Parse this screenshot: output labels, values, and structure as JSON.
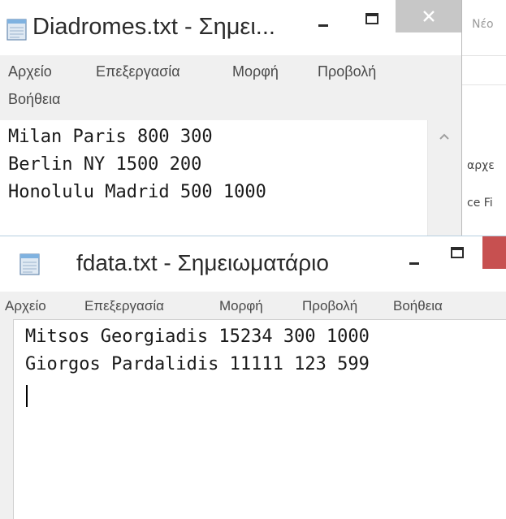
{
  "background_window": {
    "title_fragment": "Νέο",
    "fragments": [
      "αρχε",
      "ce Fi"
    ]
  },
  "window1": {
    "title": "Diadromes.txt - Σημει...",
    "controls": {
      "minimize": "–",
      "maximize": "☐",
      "close": "✕"
    },
    "menu": [
      "Αρχείο",
      "Επεξεργασία",
      "Μορφή",
      "Προβολή",
      "Βοήθεια"
    ],
    "lines": [
      "Milan Paris 800 300",
      "Berlin NY 1500 200",
      "Honolulu Madrid 500 1000"
    ]
  },
  "window2": {
    "title": "fdata.txt - Σημειωματάριο",
    "controls": {
      "minimize": "–",
      "maximize": "☐"
    },
    "menu": [
      "Αρχείο",
      "Επεξεργασία",
      "Μορφή",
      "Προβολή",
      "Βοήθεια"
    ],
    "lines": [
      "Mitsos Georgiadis 15234 300 1000",
      "Giorgos Pardalidis 11111 123 599"
    ]
  },
  "colors": {
    "window_bg": "#f0f0f0",
    "editor_bg": "#ffffff",
    "close_hover": "#c75050",
    "close_inactive": "#c7c7c7",
    "text": "#1a1a1a",
    "menu_text": "#4a4a4a"
  }
}
